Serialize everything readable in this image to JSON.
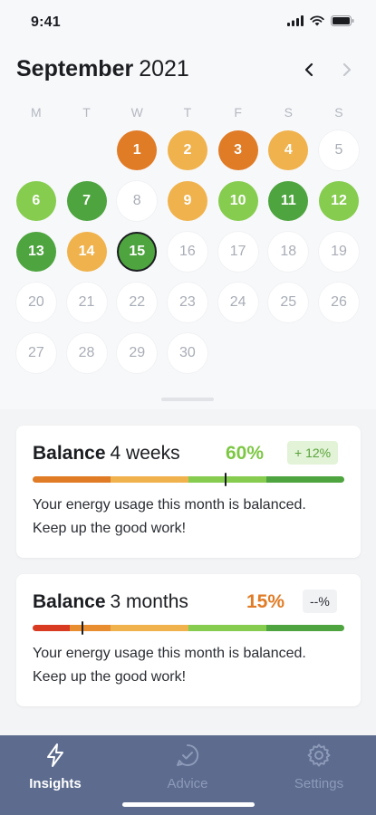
{
  "status_bar": {
    "time": "9:41"
  },
  "header": {
    "month": "September",
    "year": "2021"
  },
  "weekdays": [
    "M",
    "T",
    "W",
    "T",
    "F",
    "S",
    "S"
  ],
  "calendar": {
    "days": [
      {
        "label": "1",
        "color": "#e07b26"
      },
      {
        "label": "2",
        "color": "#f0b24d"
      },
      {
        "label": "3",
        "color": "#e07b26"
      },
      {
        "label": "4",
        "color": "#f0b24d"
      },
      {
        "label": "5",
        "color": null
      },
      {
        "label": "6",
        "color": "#86cc4f"
      },
      {
        "label": "7",
        "color": "#4ea43f"
      },
      {
        "label": "8",
        "color": null
      },
      {
        "label": "9",
        "color": "#f0b24d"
      },
      {
        "label": "10",
        "color": "#86cc4f"
      },
      {
        "label": "11",
        "color": "#4ea43f"
      },
      {
        "label": "12",
        "color": "#86cc4f"
      },
      {
        "label": "13",
        "color": "#4ea43f"
      },
      {
        "label": "14",
        "color": "#f0b24d"
      },
      {
        "label": "15",
        "color": "#4ea43f",
        "today": true
      },
      {
        "label": "16",
        "color": null
      },
      {
        "label": "17",
        "color": null
      },
      {
        "label": "18",
        "color": null
      },
      {
        "label": "19",
        "color": null
      },
      {
        "label": "20",
        "color": null
      },
      {
        "label": "21",
        "color": null
      },
      {
        "label": "22",
        "color": null
      },
      {
        "label": "23",
        "color": null
      },
      {
        "label": "24",
        "color": null
      },
      {
        "label": "25",
        "color": null
      },
      {
        "label": "26",
        "color": null
      },
      {
        "label": "27",
        "color": null
      },
      {
        "label": "28",
        "color": null
      },
      {
        "label": "29",
        "color": null
      },
      {
        "label": "30",
        "color": null
      }
    ]
  },
  "cards": [
    {
      "title_bold": "Balance",
      "title_rest": "4 weeks",
      "percent": "60%",
      "percent_color": "#7cc744",
      "badge": "+ 12%",
      "badge_bg": "#e2f3d8",
      "badge_color": "#5aa23a",
      "indicator_position": 0.62,
      "text": "Your energy usage this month is balanced. Keep up the good work!"
    },
    {
      "title_bold": "Balance",
      "title_rest": "3 months",
      "percent": "15%",
      "percent_color": "#e07b26",
      "badge": "--%",
      "badge_bg": "#f1f2f4",
      "badge_color": "#2a2d33",
      "indicator_position": 0.16,
      "text": "Your energy usage this month is balanced. Keep up the good work!"
    }
  ],
  "bar_segments": [
    {
      "color": "#d83a22",
      "share": 0.12
    },
    {
      "color": "#e88e30",
      "share": 0.13
    },
    {
      "color": "#f0b24d",
      "share": 0.25
    },
    {
      "color": "#86cc4f",
      "share": 0.25
    },
    {
      "color": "#4ea43f",
      "share": 0.25
    }
  ],
  "bar_segments_card1": [
    {
      "color": "#e07b26",
      "share": 0.25
    },
    {
      "color": "#f0b24d",
      "share": 0.25
    },
    {
      "color": "#86cc4f",
      "share": 0.25
    },
    {
      "color": "#4ea43f",
      "share": 0.25
    }
  ],
  "tabbar": {
    "tabs": [
      {
        "label": "Insights",
        "icon": "bolt-icon",
        "active": true
      },
      {
        "label": "Advice",
        "icon": "check-circle-icon",
        "active": false
      },
      {
        "label": "Settings",
        "icon": "gear-icon",
        "active": false
      }
    ]
  }
}
